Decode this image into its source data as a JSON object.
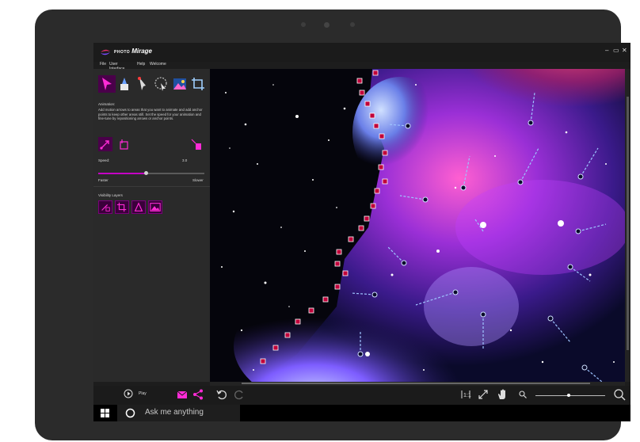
{
  "app": {
    "brand_prefix": "PHOTO",
    "brand_name": "Mirage",
    "window_controls": [
      "–",
      "▭",
      "✕"
    ]
  },
  "menu": [
    "File",
    "User Interface",
    "Help",
    "Welcome"
  ],
  "tools": [
    {
      "icon": "animate-arrow-tool-icon"
    },
    {
      "icon": "mask-brush-tool-icon"
    },
    {
      "icon": "selection-pen-tool-icon"
    },
    {
      "icon": "lasso-select-tool-icon"
    },
    {
      "icon": "overlay-image-tool-icon"
    },
    {
      "icon": "crop-tool-icon"
    }
  ],
  "animation_panel": {
    "heading": "Animation:",
    "help": "Add motion arrows to areas that you want to animate and add anchor points to keep other areas still. Set the speed for your animation and fine-tune by repositioning arrows or anchor points.",
    "speed_label": "Speed:",
    "speed_value": "3.0",
    "speed_fraction": 0.45,
    "faster_label": "Faster",
    "slower_label": "Slower"
  },
  "visibility": {
    "heading": "Visibility Layers"
  },
  "bottom": {
    "play_label": "Play"
  },
  "taskbar": {
    "search_placeholder": "Ask me anything"
  },
  "colors": {
    "accent": "#c400c4",
    "panel": "#2a2a2a",
    "titlebar": "#1b1b1b"
  }
}
